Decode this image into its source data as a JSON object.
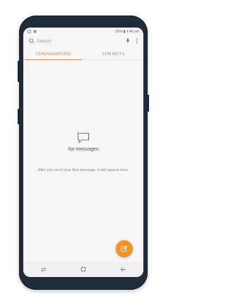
{
  "status_bar": {
    "right_text": "69% ▮ 4:46 am"
  },
  "search": {
    "placeholder": "Search"
  },
  "tabs": [
    {
      "label": "CONVERSATIONS",
      "active": true
    },
    {
      "label": "CONTACTS",
      "active": false
    }
  ],
  "empty_state": {
    "title": "No messages",
    "description": "After you send your first message, it will appear here."
  },
  "icons": {
    "search": "search-icon",
    "mic": "mic-icon",
    "more": "more-vert-icon",
    "empty": "message-bubble-icon",
    "compose": "compose-icon",
    "recents": "recent-apps-icon",
    "home": "home-icon",
    "back": "back-icon"
  },
  "colors": {
    "accent": "#ef7b2b",
    "fab": "#f29323",
    "phone_body": "#1f2c3a"
  }
}
